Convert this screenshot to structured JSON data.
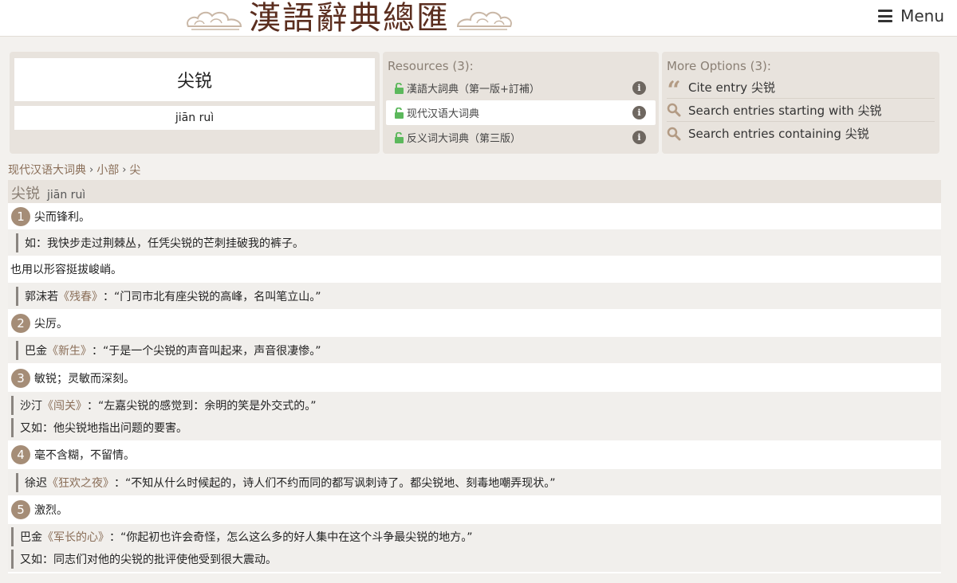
{
  "header": {
    "logo_text": "漢語辭典總匯",
    "menu_label": "Menu"
  },
  "entry": {
    "headword": "尖锐",
    "pinyin": "jiān ruì"
  },
  "resources": {
    "title": "Resources (3):",
    "items": [
      {
        "label": "漢語大詞典（第一版+訂補）"
      },
      {
        "label": "现代汉语大词典"
      },
      {
        "label": "反义词大词典（第三版）"
      }
    ]
  },
  "options": {
    "title": "More Options (3):",
    "items": [
      {
        "label": "Cite entry 尖锐",
        "icon": "quote-icon"
      },
      {
        "label": "Search entries starting with 尖锐",
        "icon": "search-icon"
      },
      {
        "label": "Search entries containing 尖锐",
        "icon": "search-icon"
      }
    ]
  },
  "breadcrumb": [
    "现代汉语大词典",
    "小部",
    "尖"
  ],
  "content": {
    "headword": "尖锐",
    "pinyin": "jiān ruì",
    "senses": [
      {
        "num": "1",
        "text": "尖而锋利。"
      },
      {
        "num": "2",
        "text": "尖厉。"
      },
      {
        "num": "3",
        "text": "敏锐；灵敏而深刻。"
      },
      {
        "num": "4",
        "text": "毫不含糊，不留情。"
      },
      {
        "num": "5",
        "text": "激烈。"
      }
    ],
    "q1": {
      "text": "如：我快步走过荆棘丛，任凭尖锐的芒刺挂破我的裤子。"
    },
    "extra": "也用以形容挺拔峻峭。",
    "q2": {
      "author": "郭沫若",
      "source": "《残春》",
      "text": "：“门司市北有座尖锐的高峰，名叫笔立山。”"
    },
    "q3": {
      "author": "巴金",
      "source": "《新生》",
      "text": "：“于是一个尖锐的声音叫起来，声音很凄惨。”"
    },
    "q4": {
      "author": "沙汀",
      "source": "《闯关》",
      "text": "：“左嘉尖锐的感觉到：余明的笑是外交式的。”"
    },
    "q5": {
      "text": "又如：他尖锐地指出问题的要害。"
    },
    "q6": {
      "author": "徐迟",
      "source": "《狂欢之夜》",
      "text": "：“不知从什么时候起的，诗人们不约而同的都写讽刺诗了。都尖锐地、刻毒地嘲弄现状。”"
    },
    "q7": {
      "author": "巴金",
      "source": "《军长的心》",
      "text": "：“你起初也许会奇怪，怎么这么多的好人集中在这个斗争最尖锐的地方。”"
    },
    "q8": {
      "text": "又如：同志们对他的尖锐的批评使他受到很大震动。"
    }
  },
  "colors": {
    "accent": "#a58d77",
    "link": "#8a6e58",
    "lock": "#5cb85c",
    "panel": "#e8e3dd"
  }
}
